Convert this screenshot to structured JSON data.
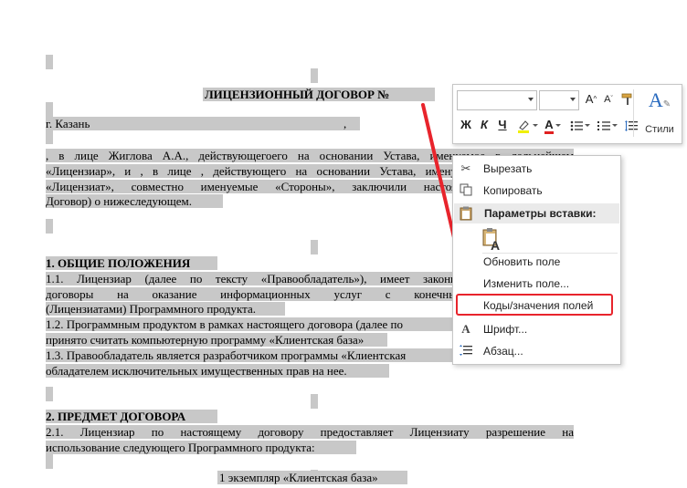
{
  "document": {
    "title": "ЛИЦЕНЗИОННЫЙ ДОГОВОР №",
    "city": "г. Казань",
    "city_comma": ",",
    "intro": [
      ", в лице Жиглова А.А., действующегоего на основании Устава, именуемое в дальнейшем",
      "«Лицензиар», и , в лице , действующего на основании Устава, имену",
      "«Лицензиат», совместно именуемые «Стороны», заключили настоя",
      "Договор) о нижеследующем."
    ],
    "section1_title": "1. ОБЩИЕ ПОЛОЖЕНИЯ",
    "section1_lines": [
      "1.1.   Лицензиар (далее по тексту «Правообладатель»), имеет законн",
      "договоры   на   оказание   информационных   услуг   с   конечны",
      "(Лицензиатами) Программного продукта.",
      "1.2. Программным продуктом в рамках настоящего договора (далее по",
      "принято считать компьютерную программу «Клиентская база»",
      "1.3. Правообладатель является разработчиком программы «Клиентская",
      "обладателем исключительных имущественных прав на нее."
    ],
    "section2_title": "2. ПРЕДМЕТ ДОГОВОРА",
    "section2_lines": [
      "2.1.  Лицензиар  по  настоящему  договору  предоставляет  Лицензиату  разрешение  на",
      "использование следующего Программного продукта:"
    ],
    "item": "1 экземпляр «Клиентская база»"
  },
  "mini_toolbar": {
    "font_name": "",
    "font_size": "",
    "grow_font": "A",
    "shrink_font": "A",
    "bold": "Ж",
    "italic": "К",
    "underline": "Ч",
    "styles_label": "Стили"
  },
  "context_menu": {
    "cut": "Вырезать",
    "copy": "Копировать",
    "paste_options": "Параметры вставки:",
    "update_field": "Обновить поле",
    "edit_field": "Изменить поле...",
    "toggle_codes": "Коды/значения полей",
    "font": "Шрифт...",
    "paragraph": "Абзац..."
  },
  "colors": {
    "field_shading": "#c8c8c8",
    "annotation_red": "#e8242c"
  }
}
